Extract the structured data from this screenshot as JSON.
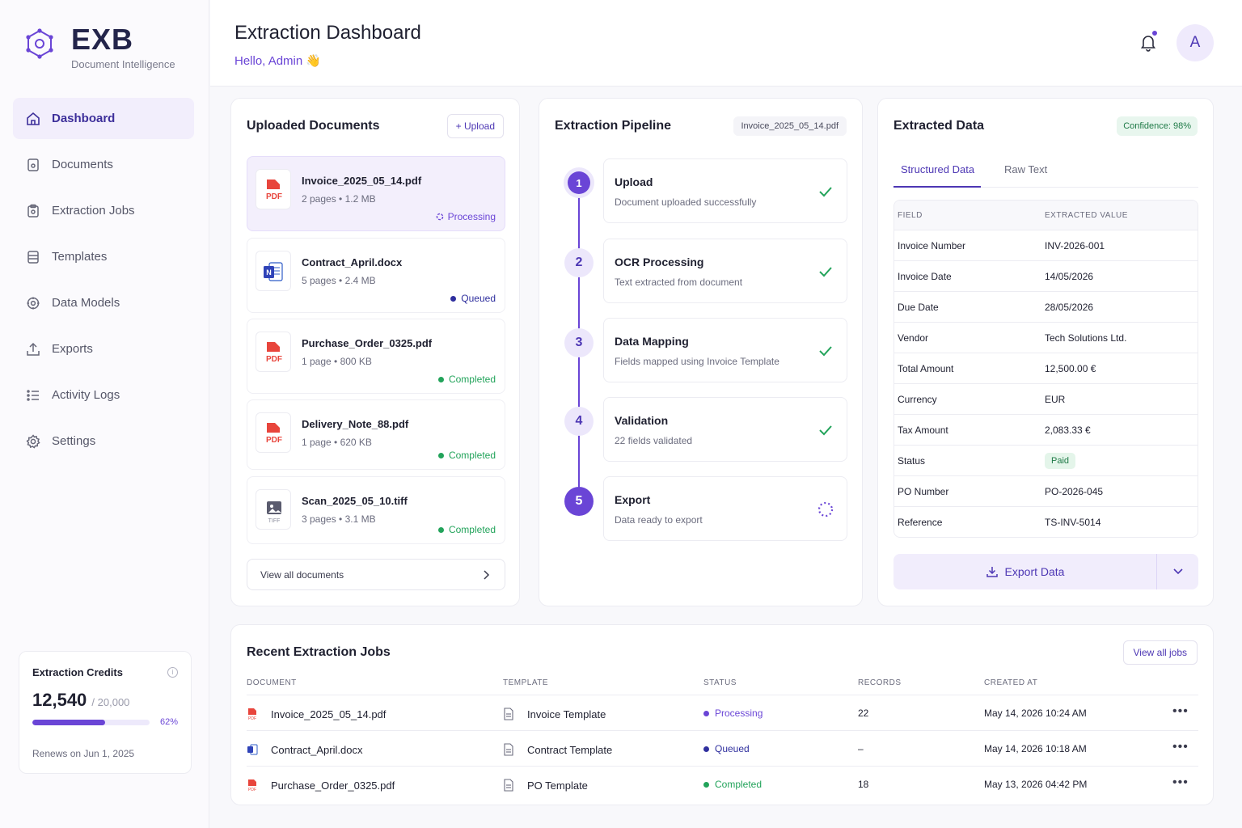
{
  "brand": {
    "name": "EXB",
    "tagline": "Document Intelligence"
  },
  "nav": [
    {
      "label": "Dashboard",
      "icon": "home-icon",
      "active": true
    },
    {
      "label": "Documents",
      "icon": "document-icon"
    },
    {
      "label": "Extraction Jobs",
      "icon": "clipboard-icon"
    },
    {
      "label": "Templates",
      "icon": "database-icon"
    },
    {
      "label": "Data Models",
      "icon": "cube-icon"
    },
    {
      "label": "Exports",
      "icon": "export-icon"
    },
    {
      "label": "Activity Logs",
      "icon": "list-icon"
    },
    {
      "label": "Settings",
      "icon": "gear-icon"
    }
  ],
  "credits": {
    "title": "Extraction Credits",
    "used": "12,540",
    "total": "/ 20,000",
    "percent": 62,
    "percent_label": "62%",
    "renew": "Renews on Jun 1, 2025"
  },
  "header": {
    "title": "Extraction Dashboard",
    "greeting": "Hello, Admin 👋",
    "avatar_initial": "A"
  },
  "uploaded": {
    "title": "Uploaded Documents",
    "upload_label": "+ Upload",
    "docs": [
      {
        "name": "Invoice_2025_05_14.pdf",
        "meta": "2 pages • 1.2 MB",
        "status": "Processing",
        "type": "pdf"
      },
      {
        "name": "Contract_April.docx",
        "meta": "5 pages • 2.4 MB",
        "status": "Queued",
        "type": "docx"
      },
      {
        "name": "Purchase_Order_0325.pdf",
        "meta": "1 page • 800 KB",
        "status": "Completed",
        "type": "pdf"
      },
      {
        "name": "Delivery_Note_88.pdf",
        "meta": "1 page • 620 KB",
        "status": "Completed",
        "type": "pdf"
      },
      {
        "name": "Scan_2025_05_10.tiff",
        "meta": "3 pages • 3.1 MB",
        "status": "Completed",
        "type": "tiff"
      }
    ],
    "view_all": "View all documents"
  },
  "pipeline": {
    "title": "Extraction Pipeline",
    "file": "Invoice_2025_05_14.pdf",
    "steps": [
      {
        "num": "1",
        "name": "Upload",
        "desc": "Document uploaded successfully"
      },
      {
        "num": "2",
        "name": "OCR Processing",
        "desc": "Text extracted from document"
      },
      {
        "num": "3",
        "name": "Data Mapping",
        "desc": "Fields mapped using Invoice Template"
      },
      {
        "num": "4",
        "name": "Validation",
        "desc": "22 fields validated"
      },
      {
        "num": "5",
        "name": "Export",
        "desc": "Data ready to export"
      }
    ]
  },
  "extracted": {
    "title": "Extracted Data",
    "confidence": "Confidence: 98%",
    "tabs": [
      "Structured Data",
      "Raw Text"
    ],
    "columns": [
      "FIELD",
      "EXTRACTED VALUE"
    ],
    "rows": [
      [
        "Invoice Number",
        "INV-2026-001"
      ],
      [
        "Invoice Date",
        "14/05/2026"
      ],
      [
        "Due Date",
        "28/05/2026"
      ],
      [
        "Vendor",
        "Tech Solutions Ltd."
      ],
      [
        "Total Amount",
        "12,500.00 €"
      ],
      [
        "Currency",
        "EUR"
      ],
      [
        "Tax Amount",
        "2,083.33 €"
      ],
      [
        "Status",
        "Paid"
      ],
      [
        "PO Number",
        "PO-2026-045"
      ],
      [
        "Reference",
        "TS-INV-5014"
      ]
    ],
    "export_label": "Export Data"
  },
  "jobs": {
    "title": "Recent Extraction Jobs",
    "view_all": "View all jobs",
    "columns": [
      "DOCUMENT",
      "TEMPLATE",
      "STATUS",
      "RECORDS",
      "CREATED AT"
    ],
    "rows": [
      {
        "doc": "Invoice_2025_05_14.pdf",
        "type": "pdf",
        "template": "Invoice Template",
        "status": "Processing",
        "records": "22",
        "created": "May 14, 2026 10:24 AM"
      },
      {
        "doc": "Contract_April.docx",
        "type": "docx",
        "template": "Contract Template",
        "status": "Queued",
        "records": "–",
        "created": "May 14, 2026 10:18 AM"
      },
      {
        "doc": "Purchase_Order_0325.pdf",
        "type": "pdf",
        "template": "PO Template",
        "status": "Completed",
        "records": "18",
        "created": "May 13, 2026 04:42 PM"
      }
    ]
  },
  "colors": {
    "accent": "#6a45d6",
    "processing": "#6a45d6",
    "queued": "#2f2f9e",
    "completed": "#22a35a"
  }
}
